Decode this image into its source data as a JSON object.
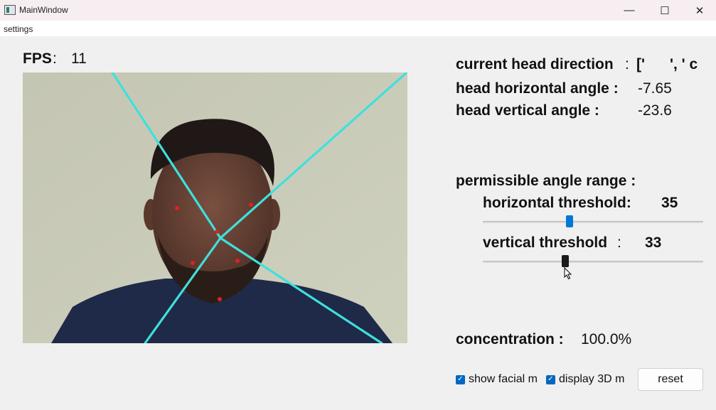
{
  "window": {
    "title": "MainWindow",
    "minimize_glyph": "—",
    "maximize_glyph": "☐",
    "close_glyph": "✕"
  },
  "menu": {
    "settings_label": "settings"
  },
  "fps": {
    "label": "FPS",
    "colon": ":",
    "value": "11"
  },
  "head": {
    "direction_label": "current head direction",
    "direction_colon": ":",
    "direction_value": "['      ', ' c",
    "horizontal_label": "head horizontal angle :",
    "horizontal_value": "-7.65",
    "vertical_label": "head vertical angle :",
    "vertical_value": "-23.6"
  },
  "range": {
    "title": "permissible angle range :",
    "horizontal_label": "horizontal threshold:",
    "horizontal_value": "35",
    "vertical_label": "vertical threshold",
    "vertical_colon": ":",
    "vertical_value": "33"
  },
  "sliders": {
    "horizontal_fraction": 0.39,
    "vertical_fraction": 0.37,
    "horizontal_color": "#0078d7",
    "vertical_color": "#1a1a1a"
  },
  "concentration": {
    "label": "concentration :",
    "value": "100.0%"
  },
  "options": {
    "show_facial_label": "show facial m",
    "show_facial_checked": true,
    "display_3d_label": "display 3D m",
    "display_3d_checked": true
  },
  "reset_label": "reset",
  "colors": {
    "overlay_line": "#3fe0dc",
    "landmark": "#e02020",
    "wall": "#c9cbb8",
    "shirt": "#1f2a48",
    "skin": "#6b4536",
    "hair": "#201816"
  }
}
